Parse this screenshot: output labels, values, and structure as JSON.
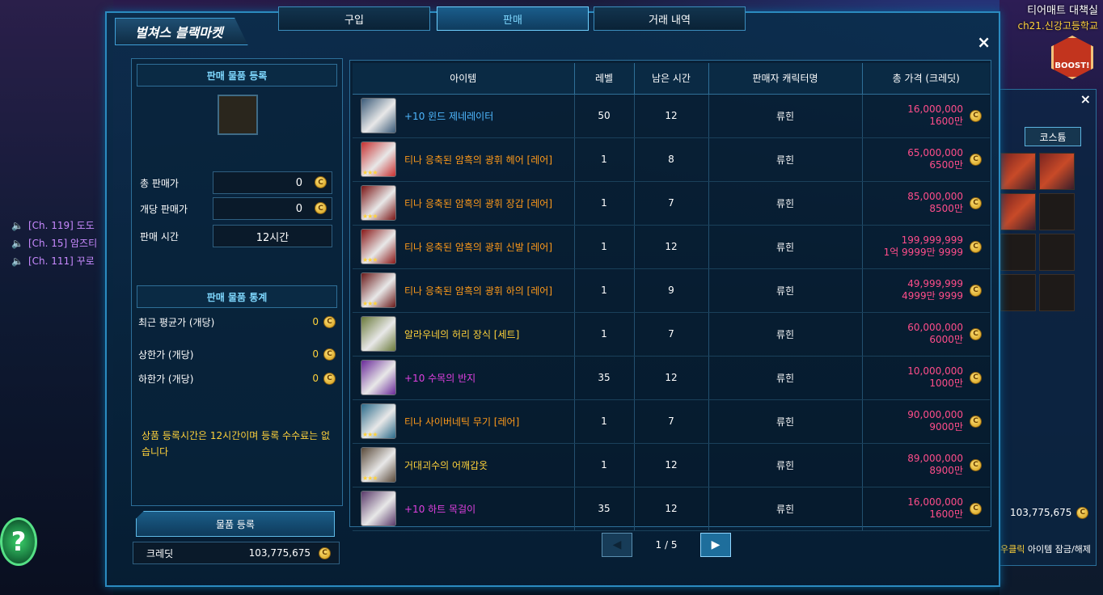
{
  "hud": {
    "zone_name": "티어매트 대책실",
    "channel": "ch21.신강고등학교",
    "boost_label": "BOOST!",
    "help_glyph": "?"
  },
  "chat": [
    {
      "text": "[Ch. 119] 도도"
    },
    {
      "text": "[Ch. 15] 암즈티"
    },
    {
      "text": "[Ch. 111] 꾸로"
    }
  ],
  "window": {
    "title": "벌쳐스 블랙마켓",
    "close_icon": "×",
    "tabs": [
      {
        "label": "구입",
        "active": false
      },
      {
        "label": "판매",
        "active": true
      },
      {
        "label": "거래 내역",
        "active": false
      }
    ]
  },
  "register": {
    "header": "판매 물품 등록",
    "fields": [
      {
        "label": "총 판매가",
        "value": "0"
      },
      {
        "label": "개당 판매가",
        "value": "0"
      },
      {
        "label": "판매 시간",
        "value": "12시간"
      }
    ]
  },
  "stats": {
    "header": "판매 물품 통계",
    "rows": [
      {
        "label": "최근 평균가 (개당)",
        "value": "0"
      },
      {
        "label": "상한가 (개당)",
        "value": "0"
      },
      {
        "label": "하한가 (개당)",
        "value": "0"
      }
    ]
  },
  "note": "상품 등록시간은 12시간이며 등록 수수료는 없습니다",
  "register_button": "물품 등록",
  "credit": {
    "label": "크레딧",
    "value": "103,775,675"
  },
  "coin_glyph": "C",
  "table": {
    "columns": [
      "아이템",
      "레벨",
      "남은 시간",
      "판매자 캐릭터명",
      "총 가격 (크레딧)"
    ],
    "rows": [
      {
        "name": "+10 윈드 제네레이터",
        "color": "#4fb8ff",
        "level": "50",
        "time": "12",
        "seller": "류힌",
        "price": "16,000,000",
        "price_kr": "1600만",
        "icon_color": "#3a5a78",
        "stars": ""
      },
      {
        "name": "티나 응축된 암흑의 광휘 헤어 [레어]",
        "color": "#ff9a1a",
        "level": "1",
        "time": "8",
        "seller": "류힌",
        "price": "65,000,000",
        "price_kr": "6500만",
        "icon_color": "#c83030",
        "stars": "★★★"
      },
      {
        "name": "티나 응축된 암흑의 광휘 장갑 [레어]",
        "color": "#ff9a1a",
        "level": "1",
        "time": "7",
        "seller": "류힌",
        "price": "85,000,000",
        "price_kr": "8500만",
        "icon_color": "#7a1414",
        "stars": "★★★"
      },
      {
        "name": "티나 응축된 암흑의 광휘 신발 [레어]",
        "color": "#ff9a1a",
        "level": "1",
        "time": "12",
        "seller": "류힌",
        "price": "199,999,999",
        "price_kr": "1억 9999만 9999",
        "icon_color": "#8a1818",
        "stars": "★★★"
      },
      {
        "name": "티나 응축된 암흑의 광휘 하의 [레어]",
        "color": "#ff9a1a",
        "level": "1",
        "time": "9",
        "seller": "류힌",
        "price": "49,999,999",
        "price_kr": "4999만 9999",
        "icon_color": "#6a1a1a",
        "stars": "★★★"
      },
      {
        "name": "알라우네의 허리 장식 [세트]",
        "color": "#ffd23a",
        "level": "1",
        "time": "7",
        "seller": "류힌",
        "price": "60,000,000",
        "price_kr": "6000만",
        "icon_color": "#6a7a3a",
        "stars": ""
      },
      {
        "name": "+10 수목의 반지",
        "color": "#e040e0",
        "level": "35",
        "time": "12",
        "seller": "류힌",
        "price": "10,000,000",
        "price_kr": "1000만",
        "icon_color": "#6a2a9a",
        "stars": ""
      },
      {
        "name": "티나 사이버네틱 무기 [레어]",
        "color": "#ff9a1a",
        "level": "1",
        "time": "7",
        "seller": "류힌",
        "price": "90,000,000",
        "price_kr": "9000만",
        "icon_color": "#2a6a8a",
        "stars": "★★★"
      },
      {
        "name": "거대괴수의 어깨갑옷",
        "color": "#ffd23a",
        "level": "1",
        "time": "12",
        "seller": "류힌",
        "price": "89,000,000",
        "price_kr": "8900만",
        "icon_color": "#5a4a3a",
        "stars": "★★★"
      },
      {
        "name": "+10 하트 목걸이",
        "color": "#e040e0",
        "level": "35",
        "time": "12",
        "seller": "류힌",
        "price": "16,000,000",
        "price_kr": "1600만",
        "icon_color": "#5a3a6a",
        "stars": ""
      }
    ]
  },
  "pager": {
    "info": "1 / 5",
    "prev": "◀",
    "next": "▶"
  },
  "inventory": {
    "close_icon": "×",
    "tab": "코스튬",
    "credit": "103,775,675",
    "hint_key": "우클릭",
    "hint_text": " 아이템 잠금/해제"
  }
}
